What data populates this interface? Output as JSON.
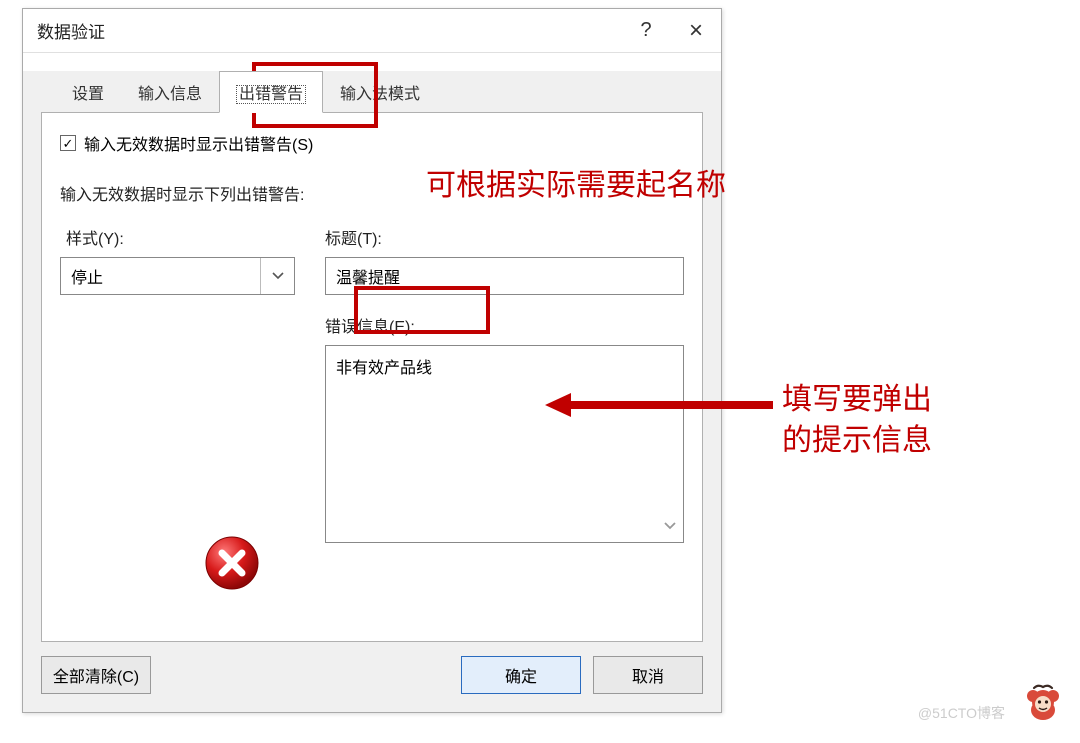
{
  "dialog": {
    "title": "数据验证",
    "help_symbol": "?",
    "close_symbol": "×"
  },
  "tabs": {
    "items": [
      {
        "label": "设置"
      },
      {
        "label": "输入信息"
      },
      {
        "label": "出错警告"
      },
      {
        "label": "输入法模式"
      }
    ],
    "active_index": 2
  },
  "form": {
    "checkbox_label": "输入无效数据时显示出错警告(S)",
    "checkbox_checked_mark": "✓",
    "section_label": "输入无效数据时显示下列出错警告:",
    "style_label": "样式(Y):",
    "style_value": "停止",
    "title_label": "标题(T):",
    "title_value": "温馨提醒",
    "error_label": "错误信息(E):",
    "error_value": "非有效产品线"
  },
  "buttons": {
    "clear_all": "全部清除(C)",
    "ok": "确定",
    "cancel": "取消"
  },
  "annotations": {
    "text1": "可根据实际需要起名称",
    "text2_line1": "填写要弹出",
    "text2_line2": "的提示信息"
  },
  "watermark": "@51CTO博客"
}
